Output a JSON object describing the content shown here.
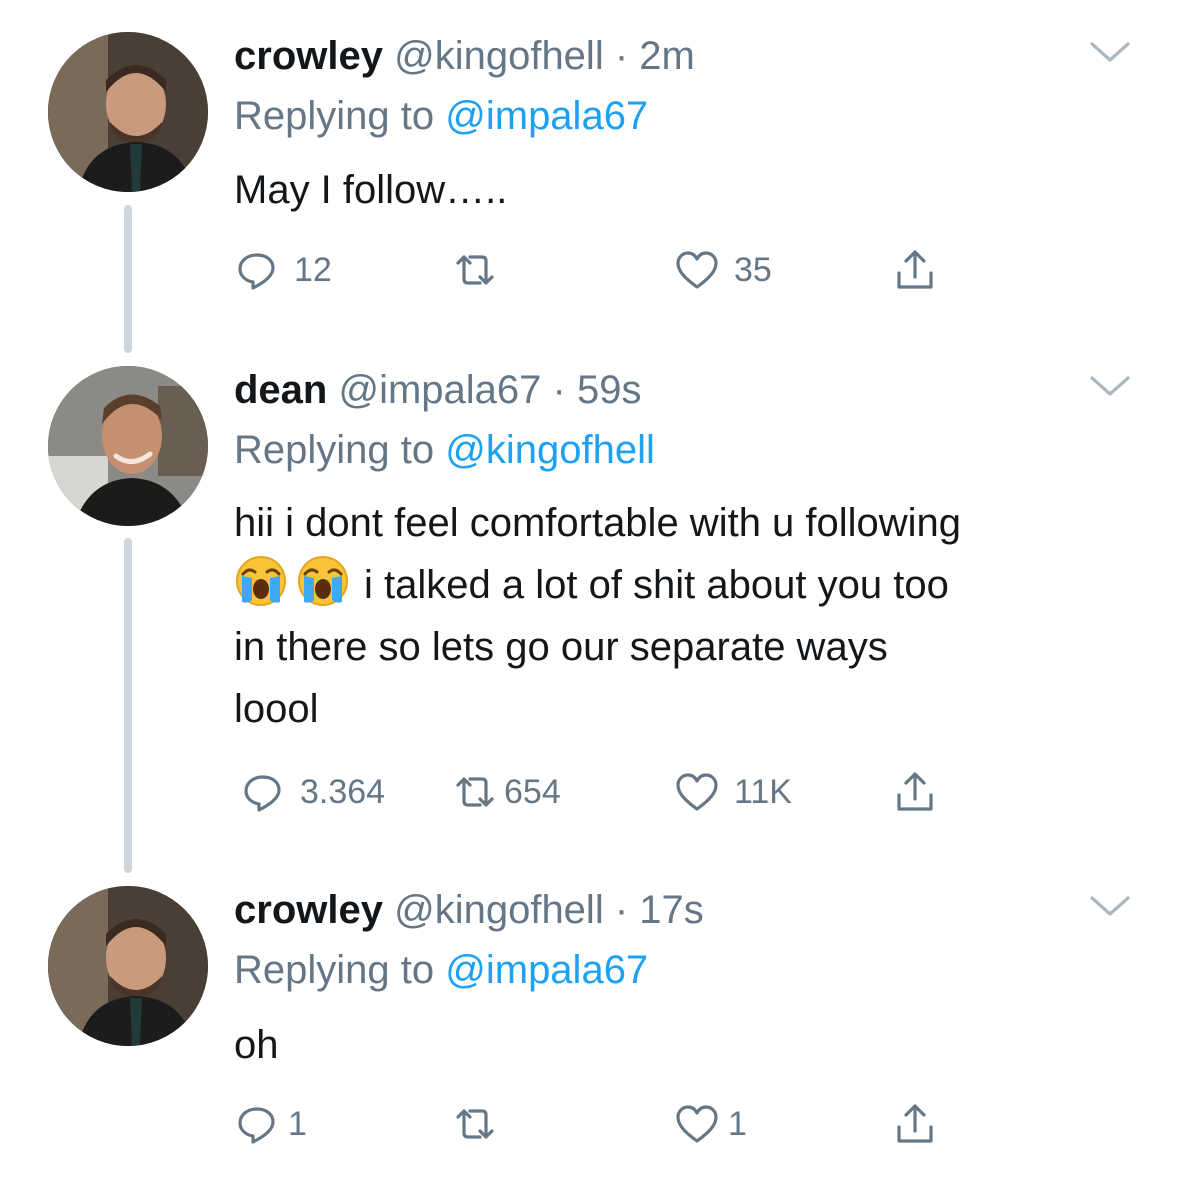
{
  "tweets": [
    {
      "name": "crowley",
      "handle": "@kingofhell",
      "dot": "·",
      "time": "2m",
      "replying_label": "Replying to",
      "replying_to": "@impala67",
      "lines": [
        "May I follow….."
      ],
      "replies": "12",
      "retweets": "",
      "likes": "35"
    },
    {
      "name": "dean",
      "handle": "@impala67",
      "dot": "·",
      "time": "59s",
      "replying_label": "Replying to",
      "replying_to": "@kingofhell",
      "line1": "hii i dont feel comfortable with u following",
      "line2": "i talked a lot of shit about you too",
      "line3": "in there so lets go our separate ways",
      "line4": "loool",
      "emoji": [
        "loudly-crying-face",
        "loudly-crying-face"
      ],
      "replies": "3.364",
      "retweets": "654",
      "likes": "11K"
    },
    {
      "name": "crowley",
      "handle": "@kingofhell",
      "dot": "·",
      "time": "17s",
      "replying_label": "Replying to",
      "replying_to": "@impala67",
      "lines": [
        "oh"
      ],
      "replies": "1",
      "retweets": "",
      "likes": "1"
    }
  ],
  "colors": {
    "text": "#14171a",
    "secondary": "#657786",
    "link": "#1da1f2",
    "thread": "#ccd6dd"
  },
  "icons": [
    "reply-icon",
    "retweet-icon",
    "like-icon",
    "share-icon",
    "chevron-down-icon"
  ]
}
